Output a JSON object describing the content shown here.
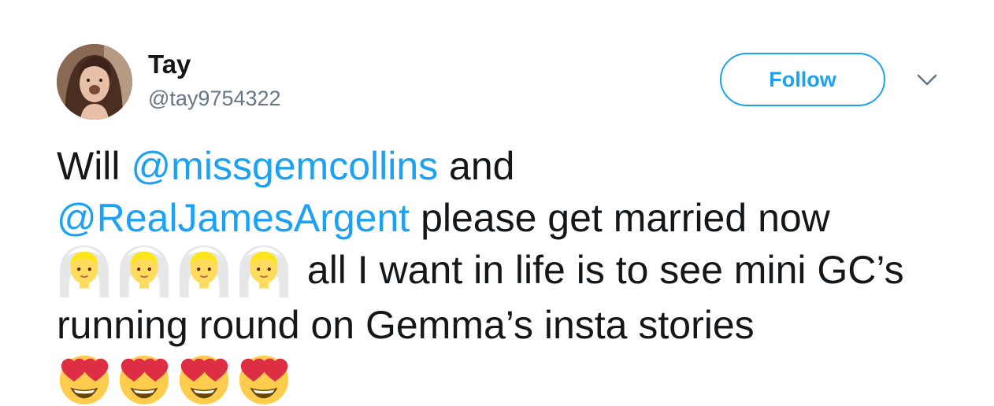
{
  "tweet": {
    "author": {
      "display_name": "Tay",
      "handle": "@tay9754322",
      "avatar_icon": "user-avatar"
    },
    "follow_label": "Follow",
    "caret_icon": "chevron-down-icon",
    "text": {
      "part1": "Will ",
      "mention1": "@missgemcollins",
      "part2": " and",
      "mention2": "@RealJamesArgent",
      "part3": " please get married now",
      "bride_emoji_icon": "bride-with-veil-emoji",
      "bride_emoji_count": 4,
      "part4": " all I want in life is to see mini GC’s running round on Gemma’s insta stories",
      "heart_eyes_emoji_icon": "smiling-face-with-heart-eyes-emoji",
      "heart_eyes_emoji_count": 4
    }
  },
  "colors": {
    "link_blue": "#1da1f2",
    "text": "#14171a",
    "secondary": "#657786"
  }
}
